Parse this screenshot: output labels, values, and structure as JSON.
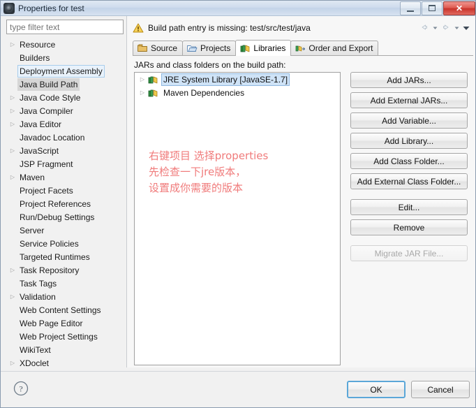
{
  "window": {
    "title": "Properties for test",
    "icon": "eclipse-app-icon",
    "controls": {
      "minimize": "minimize-icon",
      "maximize": "restore-icon",
      "close": "✕"
    }
  },
  "sidebar": {
    "filter": {
      "value": "",
      "placeholder": "type filter text"
    },
    "items": [
      {
        "label": "Resource",
        "expandable": true,
        "state": "normal"
      },
      {
        "label": "Builders",
        "expandable": false,
        "state": "normal"
      },
      {
        "label": "Deployment Assembly",
        "expandable": false,
        "state": "focused"
      },
      {
        "label": "Java Build Path",
        "expandable": false,
        "state": "selected"
      },
      {
        "label": "Java Code Style",
        "expandable": true,
        "state": "normal"
      },
      {
        "label": "Java Compiler",
        "expandable": true,
        "state": "normal"
      },
      {
        "label": "Java Editor",
        "expandable": true,
        "state": "normal"
      },
      {
        "label": "Javadoc Location",
        "expandable": false,
        "state": "normal"
      },
      {
        "label": "JavaScript",
        "expandable": true,
        "state": "normal"
      },
      {
        "label": "JSP Fragment",
        "expandable": false,
        "state": "normal"
      },
      {
        "label": "Maven",
        "expandable": true,
        "state": "normal"
      },
      {
        "label": "Project Facets",
        "expandable": false,
        "state": "normal"
      },
      {
        "label": "Project References",
        "expandable": false,
        "state": "normal"
      },
      {
        "label": "Run/Debug Settings",
        "expandable": false,
        "state": "normal"
      },
      {
        "label": "Server",
        "expandable": false,
        "state": "normal"
      },
      {
        "label": "Service Policies",
        "expandable": false,
        "state": "normal"
      },
      {
        "label": "Targeted Runtimes",
        "expandable": false,
        "state": "normal"
      },
      {
        "label": "Task Repository",
        "expandable": true,
        "state": "normal"
      },
      {
        "label": "Task Tags",
        "expandable": false,
        "state": "normal"
      },
      {
        "label": "Validation",
        "expandable": true,
        "state": "normal"
      },
      {
        "label": "Web Content Settings",
        "expandable": false,
        "state": "normal"
      },
      {
        "label": "Web Page Editor",
        "expandable": false,
        "state": "normal"
      },
      {
        "label": "Web Project Settings",
        "expandable": false,
        "state": "normal"
      },
      {
        "label": "WikiText",
        "expandable": false,
        "state": "normal"
      },
      {
        "label": "XDoclet",
        "expandable": true,
        "state": "normal"
      }
    ]
  },
  "message": {
    "icon": "warning-icon",
    "text": "Build path entry is missing: test/src/test/java",
    "nav": {
      "back": "back-arrow-icon",
      "back_menu": "chevron-down-icon",
      "forward": "forward-arrow-icon",
      "forward_menu": "chevron-down-icon",
      "menu": "chevron-down-icon"
    }
  },
  "tabs": [
    {
      "label": "Source",
      "icon": "source-folder-icon",
      "active": false
    },
    {
      "label": "Projects",
      "icon": "open-folder-icon",
      "active": false
    },
    {
      "label": "Libraries",
      "icon": "library-icon",
      "active": true
    },
    {
      "label": "Order and Export",
      "icon": "order-export-icon",
      "active": false
    }
  ],
  "main": {
    "list_label": "JARs and class folders on the build path:",
    "entries": [
      {
        "label": "JRE System Library [JavaSE-1.7]",
        "icon": "library-icon",
        "expandable": true,
        "selected": true
      },
      {
        "label": "Maven Dependencies",
        "icon": "library-icon",
        "expandable": true,
        "selected": false
      }
    ],
    "annotation": {
      "color": "#f07b7b",
      "lines": [
        "右键项目 选择properties",
        "先检查一下jre版本，",
        "设置成你需要的版本"
      ]
    },
    "buttons": [
      {
        "label": "Add JARs...",
        "enabled": true,
        "gap": false
      },
      {
        "label": "Add External JARs...",
        "enabled": true,
        "gap": false
      },
      {
        "label": "Add Variable...",
        "enabled": true,
        "gap": false
      },
      {
        "label": "Add Library...",
        "enabled": true,
        "gap": false
      },
      {
        "label": "Add Class Folder...",
        "enabled": true,
        "gap": false
      },
      {
        "label": "Add External Class Folder...",
        "enabled": true,
        "gap": false
      },
      {
        "label": "Edit...",
        "enabled": true,
        "gap": true
      },
      {
        "label": "Remove",
        "enabled": true,
        "gap": false
      },
      {
        "label": "Migrate JAR File...",
        "enabled": false,
        "gap": true
      }
    ]
  },
  "footer": {
    "help_icon": "help-icon",
    "ok_label": "OK",
    "cancel_label": "Cancel"
  }
}
